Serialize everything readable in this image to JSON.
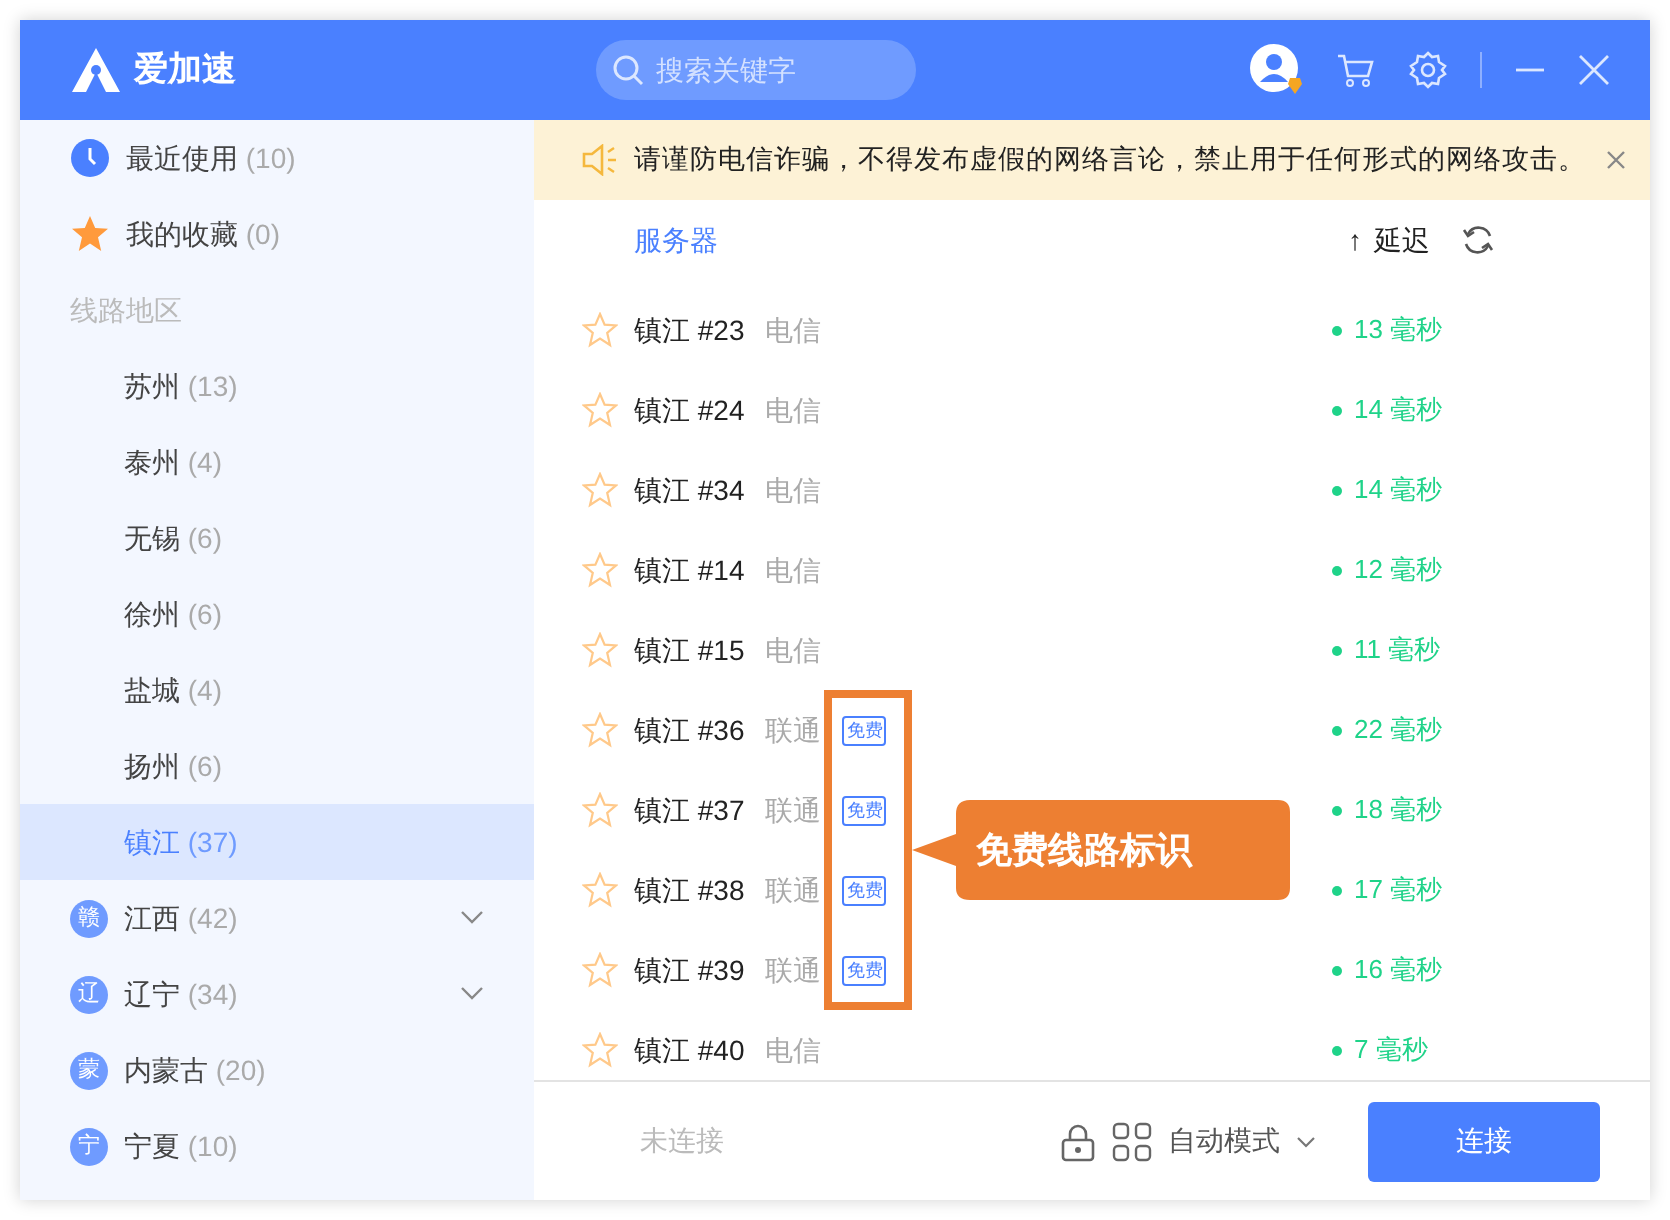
{
  "app": {
    "title": "爱加速"
  },
  "search": {
    "placeholder": "搜索关键字"
  },
  "sidebar": {
    "items": [
      {
        "kind": "recent",
        "label": "最近使用",
        "count": "(10)",
        "selected": false
      },
      {
        "kind": "favorite",
        "label": "我的收藏",
        "count": "(0)",
        "selected": false
      },
      {
        "kind": "section",
        "label": "线路地区"
      },
      {
        "kind": "city",
        "label": "苏州",
        "count": "(13)",
        "selected": false
      },
      {
        "kind": "city",
        "label": "泰州",
        "count": "(4)",
        "selected": false
      },
      {
        "kind": "city",
        "label": "无锡",
        "count": "(6)",
        "selected": false
      },
      {
        "kind": "city",
        "label": "徐州",
        "count": "(6)",
        "selected": false
      },
      {
        "kind": "city",
        "label": "盐城",
        "count": "(4)",
        "selected": false
      },
      {
        "kind": "city",
        "label": "扬州",
        "count": "(6)",
        "selected": false
      },
      {
        "kind": "city",
        "label": "镇江",
        "count": "(37)",
        "selected": true
      },
      {
        "kind": "province",
        "badge": "赣",
        "label": "江西",
        "count": "(42)",
        "selected": false,
        "collapsible": true
      },
      {
        "kind": "province",
        "badge": "辽",
        "label": "辽宁",
        "count": "(34)",
        "selected": false,
        "collapsible": true
      },
      {
        "kind": "province",
        "badge": "蒙",
        "label": "内蒙古",
        "count": "(20)",
        "selected": false,
        "collapsible": false
      },
      {
        "kind": "province",
        "badge": "宁",
        "label": "宁夏",
        "count": "(10)",
        "selected": false,
        "collapsible": false
      }
    ]
  },
  "notice": {
    "text": "请谨防电信诈骗，不得发布虚假的网络言论，禁止用于任何形式的网络攻击。"
  },
  "table": {
    "columns": [
      "服务器",
      "延迟"
    ],
    "sort_indicator": "↑",
    "rows": [
      {
        "name": "镇江 #23",
        "carrier": "电信",
        "free": false,
        "latency": "13 毫秒"
      },
      {
        "name": "镇江 #24",
        "carrier": "电信",
        "free": false,
        "latency": "14 毫秒"
      },
      {
        "name": "镇江 #34",
        "carrier": "电信",
        "free": false,
        "latency": "14 毫秒"
      },
      {
        "name": "镇江 #14",
        "carrier": "电信",
        "free": false,
        "latency": "12 毫秒"
      },
      {
        "name": "镇江 #15",
        "carrier": "电信",
        "free": false,
        "latency": "11 毫秒"
      },
      {
        "name": "镇江 #36",
        "carrier": "联通",
        "free": true,
        "badge": "免费",
        "latency": "22 毫秒"
      },
      {
        "name": "镇江 #37",
        "carrier": "联通",
        "free": true,
        "badge": "免费",
        "latency": "18 毫秒"
      },
      {
        "name": "镇江 #38",
        "carrier": "联通",
        "free": true,
        "badge": "免费",
        "latency": "17 毫秒"
      },
      {
        "name": "镇江 #39",
        "carrier": "联通",
        "free": true,
        "badge": "免费",
        "latency": "16 毫秒"
      },
      {
        "name": "镇江 #40",
        "carrier": "电信",
        "free": false,
        "latency": "7 毫秒"
      }
    ]
  },
  "annotation": {
    "text": "免费线路标识"
  },
  "footer": {
    "status": "未连接",
    "mode": "自动模式",
    "connect_button": "连接"
  }
}
